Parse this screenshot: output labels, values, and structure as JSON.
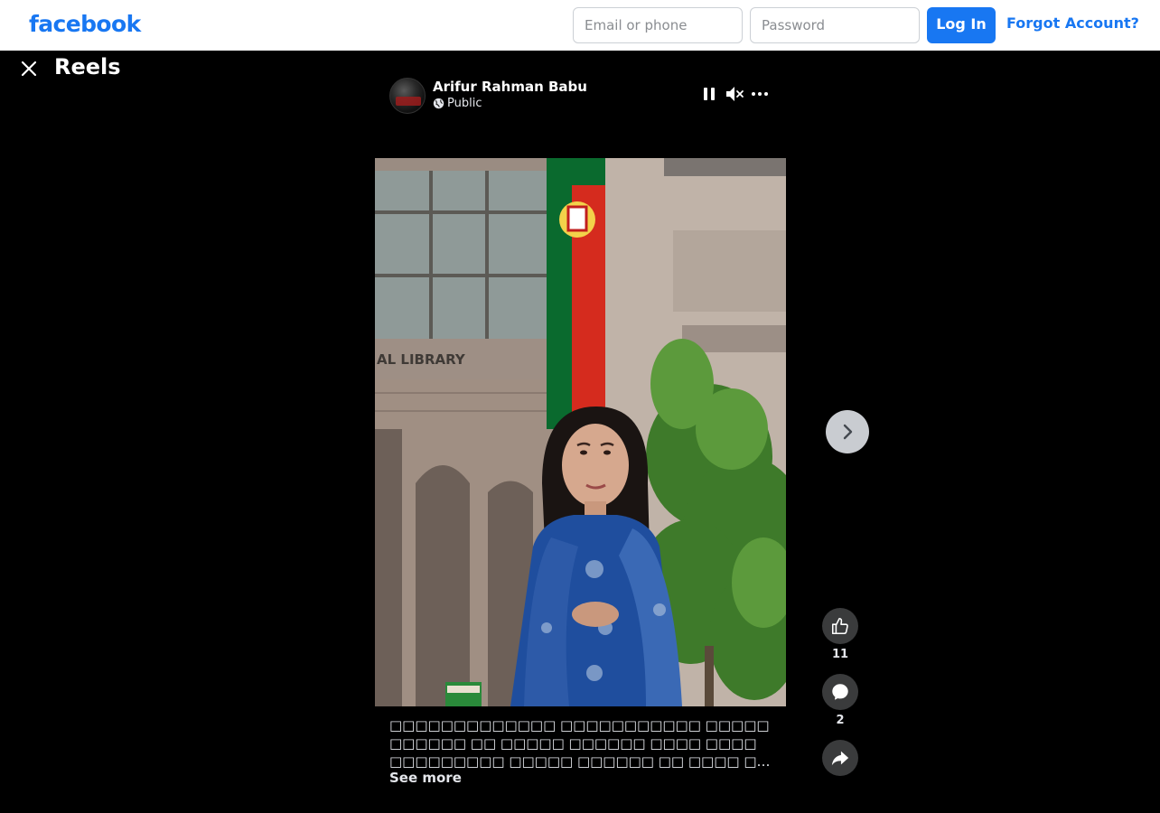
{
  "header": {
    "logo": "facebook",
    "email_placeholder": "Email or phone",
    "password_placeholder": "Password",
    "login_label": "Log In",
    "forgot_label": "Forgot Account?"
  },
  "reels": {
    "title": "Reels"
  },
  "post": {
    "author": "Arifur Rahman Babu",
    "privacy": "Public",
    "caption": "□□□□□□□□□□□□□ □□□□□□□□□□□ □□□□□□□□□□□ □□ □□□□□ □□□□□□ □□□□ □□□□ □□□□□□□□□ □□□□□ □□□□□□ □□ □□□□ □□□ □□□□□□ □□□□□ □□□ □□□□□ □□□ □□□□□□□ □□□□ □□□ □□□□□□□□□□ □□…",
    "see_more": "See more",
    "likes": "11",
    "comments": "2"
  },
  "video_scene": {
    "building_sign": "AL LIBRARY"
  },
  "colors": {
    "brand": "#1877f2",
    "background": "#000000",
    "action_button": "#3a3b3c"
  },
  "icons": [
    "close-icon",
    "globe-icon",
    "pause-icon",
    "muted-speaker-icon",
    "more-icon",
    "chevron-right-icon",
    "like-icon",
    "comment-icon",
    "share-icon"
  ]
}
